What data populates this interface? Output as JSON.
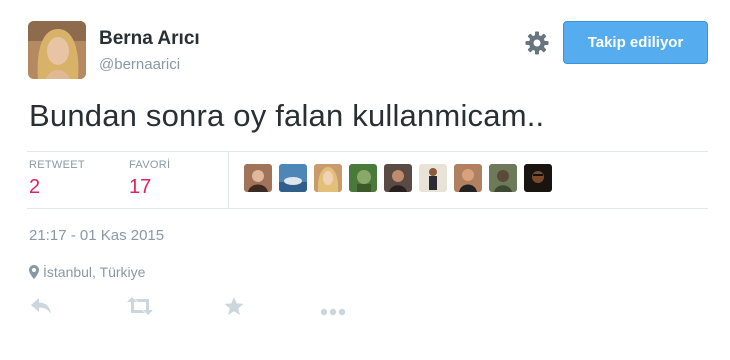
{
  "user": {
    "name": "Berna Arıcı",
    "handle": "@bernaarici"
  },
  "follow_button": {
    "label": "Takip ediliyor"
  },
  "tweet": {
    "text": "Bundan sonra oy falan kullanmicam.."
  },
  "stats": {
    "retweet_label": "RETWEET",
    "retweet_count": "2",
    "fav_label": "FAVORİ",
    "fav_count": "17"
  },
  "favoriters_count": 9,
  "meta": {
    "timestamp": "21:17 - 01 Kas 2015",
    "location": "İstanbul, Türkiye"
  },
  "colors": {
    "accent": "#55acee",
    "count": "#e0245e",
    "muted": "#8899a6",
    "icon": "#ccd6dd"
  },
  "icons": [
    "settings-gear-icon",
    "location-pin-icon",
    "reply-icon",
    "retweet-icon",
    "favorite-star-icon",
    "more-icon"
  ]
}
